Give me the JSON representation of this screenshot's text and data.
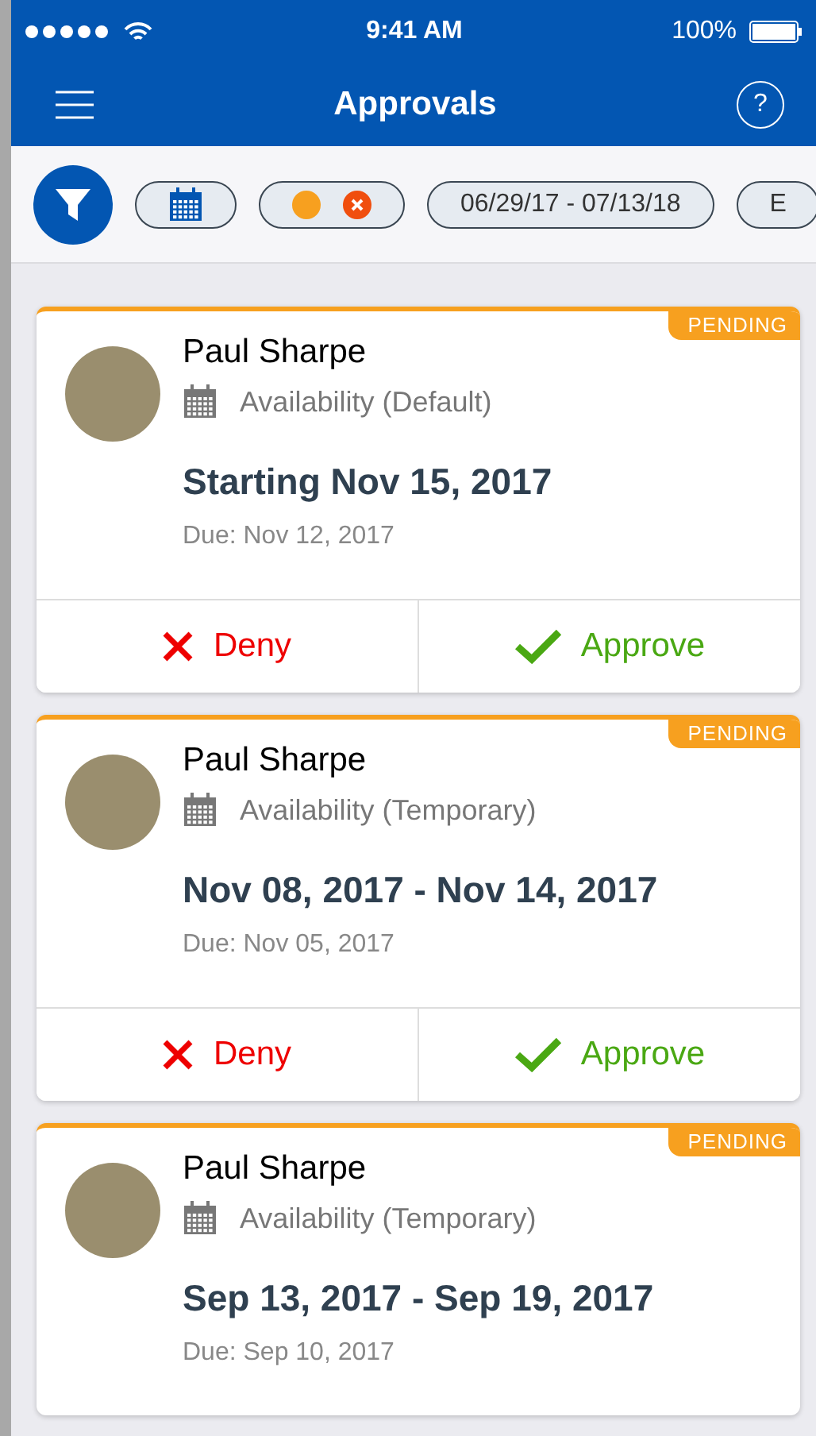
{
  "status_bar": {
    "time": "9:41 AM",
    "battery": "100%"
  },
  "nav": {
    "title": "Approvals",
    "help": "?"
  },
  "filters": [
    {
      "kind": "calendar"
    },
    {
      "kind": "status"
    },
    {
      "kind": "text",
      "label": "06/29/17 - 07/13/18"
    },
    {
      "kind": "text",
      "label": "E"
    }
  ],
  "cards": [
    {
      "name": "Paul Sharpe",
      "type": "Availability (Default)",
      "title": "Starting Nov 15, 2017",
      "due": "Due: Nov 12, 2017",
      "badge": "PENDING",
      "actions": [
        {
          "kind": "deny",
          "label": "Deny"
        },
        {
          "kind": "approve",
          "label": "Approve"
        }
      ]
    },
    {
      "name": "Paul Sharpe",
      "type": "Availability (Temporary)",
      "title": "Nov 08, 2017 - Nov 14, 2017",
      "due": "Due: Nov 05, 2017",
      "badge": "PENDING",
      "actions": [
        {
          "kind": "deny",
          "label": "Deny"
        },
        {
          "kind": "approve",
          "label": "Approve"
        }
      ]
    },
    {
      "name": "Paul Sharpe",
      "type": "Availability (Temporary)",
      "title": "Sep 13, 2017 - Sep 19, 2017",
      "due": "Due: Sep 10, 2017",
      "badge": "PENDING"
    }
  ]
}
